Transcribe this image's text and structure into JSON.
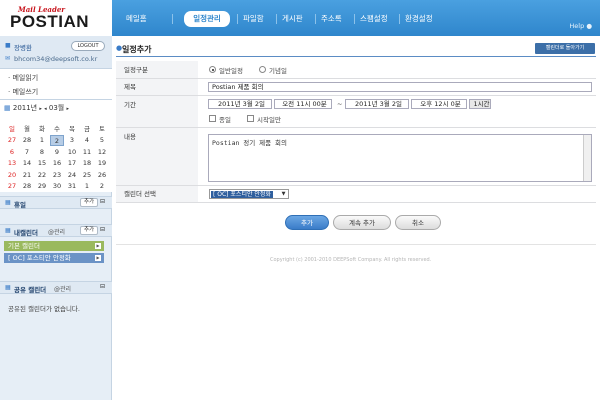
{
  "logo": {
    "tagline": "Mail Leader",
    "name": "POSTIAN"
  },
  "nav": {
    "items": [
      "메일홈",
      "일정관리",
      "파일함",
      "게시판",
      "주소록",
      "스팸설정",
      "환경설정"
    ],
    "active_index": 1,
    "help": "Help"
  },
  "user": {
    "name": "장병환",
    "logout": "LOGOUT",
    "email": "bhcom34@deepsoft.co.kr"
  },
  "mail_menu": [
    "· 메일읽기",
    "· 메일쓰기"
  ],
  "mini_calendar": {
    "year_label": "2011년",
    "month_label": "03월",
    "weekdays": [
      "일",
      "월",
      "화",
      "수",
      "목",
      "금",
      "토"
    ],
    "weeks": [
      [
        "27",
        "28",
        "1",
        "2",
        "3",
        "4",
        "5"
      ],
      [
        "6",
        "7",
        "8",
        "9",
        "10",
        "11",
        "12"
      ],
      [
        "13",
        "14",
        "15",
        "16",
        "17",
        "18",
        "19"
      ],
      [
        "20",
        "21",
        "22",
        "23",
        "24",
        "25",
        "26"
      ],
      [
        "27",
        "28",
        "29",
        "30",
        "31",
        "1",
        "2"
      ]
    ],
    "today": "2"
  },
  "sections": {
    "holiday": {
      "title": "휴일",
      "add": "추가"
    },
    "my_calendar": {
      "title": "내캘린더",
      "manage": "@관리",
      "add": "추가"
    },
    "shared_calendar": {
      "title": "공유 캘린더",
      "manage": "@관리",
      "empty": "공유된 캘린더가 없습니다."
    }
  },
  "my_calendars": [
    "기본 캘린더",
    "[ OC] 포스티안 안정화"
  ],
  "main": {
    "title": "일정추가",
    "back_button": "캘린더로 돌아가기",
    "labels": {
      "type": "일정구분",
      "subject": "제목",
      "period": "기간",
      "contents": "내용",
      "calendar": "캘린더 선택"
    },
    "type_options": [
      "일반일정",
      "기념일"
    ],
    "type_selected": 0,
    "subject": "Postian 제품 회의",
    "start_date": "2011년 3월 2일",
    "start_time": "오전 11시 00분",
    "dash": "~",
    "end_date": "2011년 3월 2일",
    "end_time": "오후 12시 0분",
    "duration": "1시간",
    "allday": "종일",
    "no_end": "시작일만",
    "contents": "Postian 정기 제품 회의",
    "calendar_selected": "[ OC] 포스티안 안정화",
    "buttons": {
      "add": "추가",
      "add_more": "계속 추가",
      "cancel": "취소"
    }
  },
  "footer": {
    "copyright": "Copyright (c) 2001-2010 DEEPSoft Company. All rights reserved."
  },
  "colors": {
    "nav_blue": "#3d93d6",
    "basic_calendar": "#9ab95e",
    "bidding_calendar": "#6b93c6"
  }
}
